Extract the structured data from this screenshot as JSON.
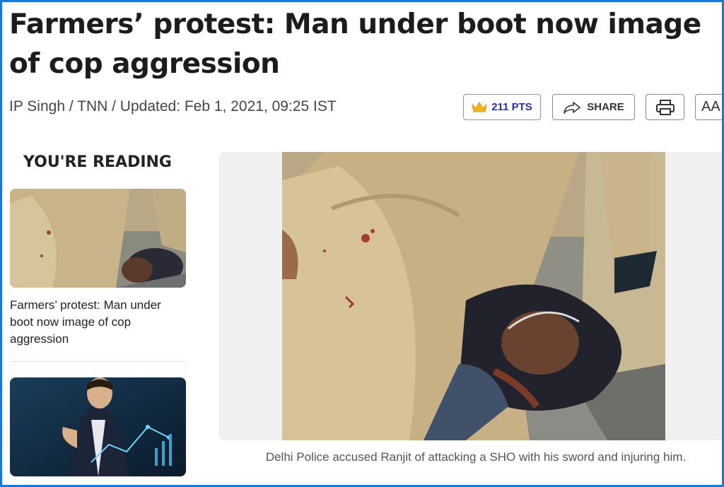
{
  "article": {
    "headline": "Farmers’ protest: Man under boot now image of cop aggression",
    "byline": "IP Singh / TNN / Updated: Feb 1, 2021, 09:25 IST"
  },
  "toolbar": {
    "points_label": "211 PTS",
    "share_label": "SHARE",
    "font_size_label": "AA"
  },
  "sidebar": {
    "heading": "YOU'RE READING",
    "items": [
      {
        "caption": "Farmers’ protest: Man under boot now image of cop aggression"
      },
      {
        "caption": ""
      }
    ]
  },
  "main_image": {
    "caption": "Delhi Police accused Ranjit of attacking a SHO with his sword and injuring him."
  },
  "colors": {
    "frame_border": "#1b79d6",
    "points_accent": "#2c2cb0",
    "crown": "#f0b41e"
  },
  "icons": [
    "crown-icon",
    "share-icon",
    "print-icon"
  ]
}
